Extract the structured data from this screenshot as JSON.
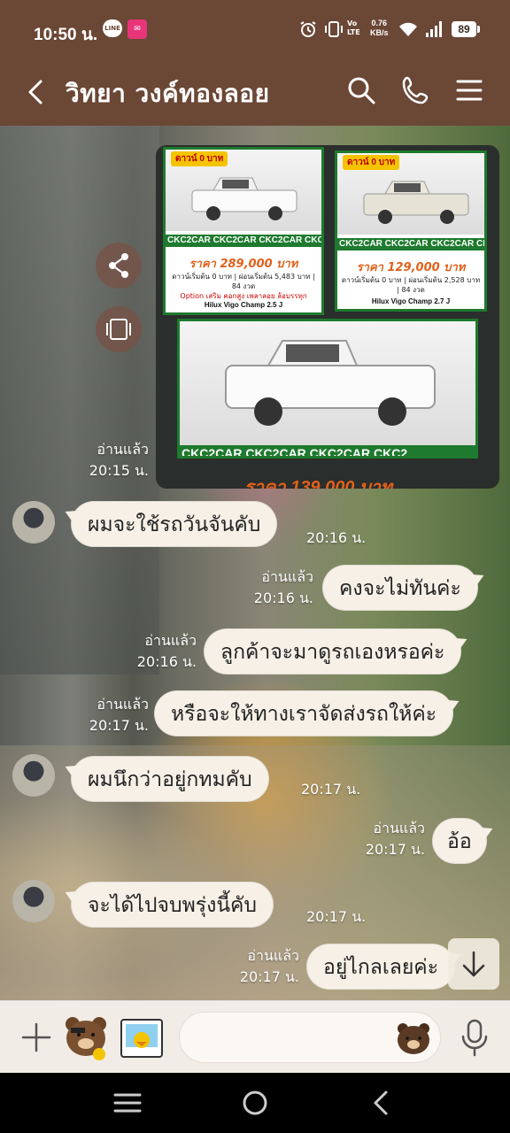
{
  "status_bar": {
    "time": "10:50 น.",
    "line_icon_label": "LINE",
    "net_speed": "0.76",
    "net_speed_unit": "KB/s",
    "volte": "Vo LTE",
    "battery": "89",
    "icons": [
      "line-icon",
      "cc-app-icon",
      "alarm-icon",
      "vibrate-icon",
      "volte-icon",
      "wifi-icon",
      "signal-icon",
      "battery-icon"
    ]
  },
  "header": {
    "title": "วิทยา วงค์ทองลอย",
    "back_icon": "back-arrow-icon",
    "search_icon": "search-icon",
    "call_icon": "phone-icon",
    "menu_icon": "menu-icon"
  },
  "image_post": {
    "read_label": "อ่านแล้ว",
    "time": "20:15 น.",
    "cards": [
      {
        "badge": "ดาวน์ 0 บาท",
        "band": "CKC2CAR CKC2CAR CKC2CAR CKC2",
        "price": "ราคา 289,000 บาท",
        "terms": "ดาวน์เริ่มต้น 0 บาท | ผ่อนเริ่มต้น 5,483 บาท | 84 งวด",
        "terms2": "Option เสริม คอกสูง เพลาลอย ล้อบรรทุก",
        "model": "Hilux Vigo Champ 2.5 J"
      },
      {
        "badge": "ดาวน์ 0 บาท",
        "band": "CKC2CAR CKC2CAR CKC2CAR CKC2",
        "price": "ราคา 129,000 บาท",
        "terms": "ดาวน์เริ่มต้น 0 บาท | ผ่อนเริ่มต้น 2,528 บาท | 84 งวด",
        "terms2": "",
        "model": "Hilux Vigo Champ 2.7 J"
      },
      {
        "badge": "",
        "band": "CKC2CAR CKC2CAR CKC2CAR CKC2",
        "price": "",
        "terms": "",
        "terms2": "",
        "model": ""
      }
    ],
    "bottom_price": "ราคา 139,000 บาท"
  },
  "messages": [
    {
      "direction": "in",
      "text": "ผมจะใช้รถวันจันคับ",
      "time": "20:16 น."
    },
    {
      "direction": "out",
      "read": "อ่านแล้ว",
      "text": "คงจะไม่ทันค่ะ",
      "time": "20:16 น."
    },
    {
      "direction": "out",
      "read": "อ่านแล้ว",
      "text": "ลูกค้าจะมาดูรถเองหรอค่ะ",
      "time": "20:16 น."
    },
    {
      "direction": "out",
      "read": "อ่านแล้ว",
      "text": "หรือจะให้ทางเราจัดส่งรถให้ค่ะ",
      "time": "20:17 น."
    },
    {
      "direction": "in",
      "text": "ผมนึกว่าอยู่กทมคับ",
      "time": "20:17 น."
    },
    {
      "direction": "out",
      "read": "อ่านแล้ว",
      "text": "อ้อ",
      "time": "20:17 น."
    },
    {
      "direction": "in",
      "text": "จะได้ไปจบพรุ่งนี้คับ",
      "time": "20:17 น."
    },
    {
      "direction": "out",
      "read": "อ่านแล้ว",
      "text": "อยู่ไกลเลยค่ะ",
      "time": "20:17 น."
    }
  ],
  "input_bar": {
    "placeholder": "",
    "icons": [
      "plus-icon",
      "brown-bear-sticker-icon",
      "sally-sticker-icon",
      "emoji-icon",
      "microphone-icon"
    ]
  },
  "colors": {
    "header_bg": "#6b4736",
    "bubble_bg": "#f6f0e6",
    "input_bar_bg": "#f2ece6"
  }
}
